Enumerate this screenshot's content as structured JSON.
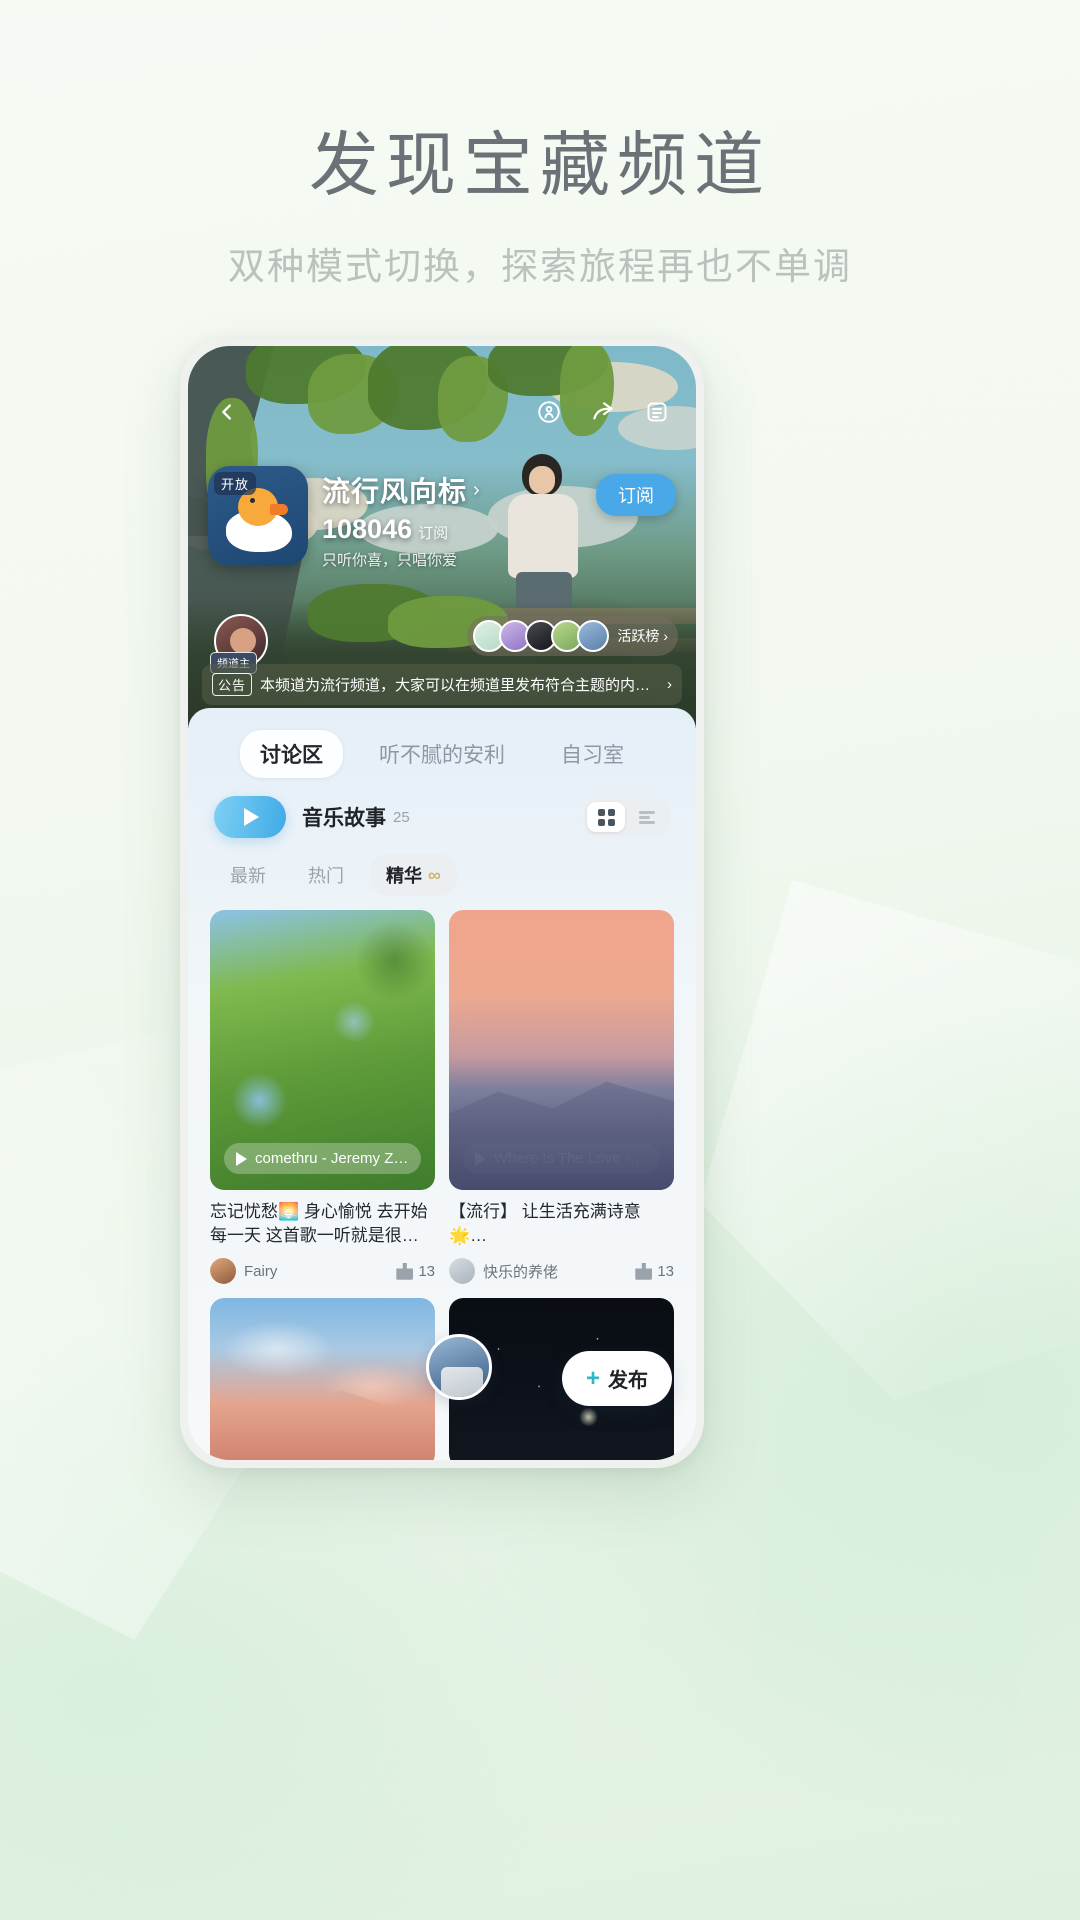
{
  "promo": {
    "headline": "发现宝藏频道",
    "subhead": "双种模式切换，探索旅程再也不单调"
  },
  "app": {
    "topbar": {
      "back_icon": "chevron-left-icon",
      "live_icon": "broadcast-icon",
      "share_icon": "share-icon",
      "menu_icon": "list-icon"
    },
    "channel": {
      "open_tag": "开放",
      "name": "流行风向标",
      "name_chevron": "›",
      "subscriber_count": "108046",
      "subscriber_unit": "订阅",
      "slogan": "只听你喜，只唱你爱",
      "subscribe_label": "订阅",
      "owner_tag": "频道主",
      "active_label": "活跃榜",
      "active_chevron": "›"
    },
    "notice": {
      "badge": "公告",
      "text": "本频道为流行频道，大家可以在频道里发布符合主题的内容…",
      "chevron": "›"
    },
    "tabs": [
      {
        "label": "讨论区",
        "active": true
      },
      {
        "label": "听不腻的安利",
        "active": false
      },
      {
        "label": "自习室",
        "active": false
      }
    ],
    "story": {
      "play_icon": "play-icon",
      "title": "音乐故事",
      "count": "25",
      "grid_view_icon": "grid-view-icon",
      "list_view_icon": "list-view-icon"
    },
    "filters": [
      {
        "label": "最新",
        "active": false,
        "suffix": ""
      },
      {
        "label": "热门",
        "active": false,
        "suffix": ""
      },
      {
        "label": "精华",
        "active": true,
        "suffix": "∞"
      }
    ],
    "posts": [
      {
        "song": "comethru - Jeremy Z…",
        "caption": "忘记忧愁🌅 身心愉悦 去开始每一天 这首歌一听就是很…",
        "author": "Fairy",
        "likes": "13"
      },
      {
        "song": "Where Is The Love - …",
        "caption": "【流行】\n让生活充满诗意🌟…",
        "author": "快乐的养佬",
        "likes": "13"
      },
      {
        "song": "",
        "caption": "",
        "author": "",
        "likes": ""
      },
      {
        "song": "",
        "caption": "",
        "author": "",
        "likes": ""
      }
    ],
    "fab": {
      "plus": "+",
      "label": "发布"
    }
  },
  "colors": {
    "accent_blue": "#49a8e8",
    "accent_teal": "#2fb7c9",
    "headline_gray": "#6b7176",
    "subhead_gray": "#b9c2bc"
  }
}
